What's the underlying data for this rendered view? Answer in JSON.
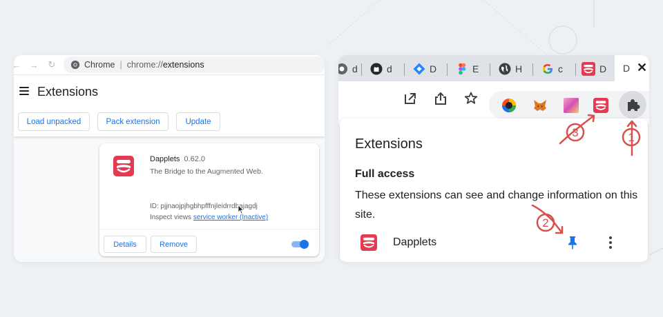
{
  "colors": {
    "background": "#eef1f4",
    "accent_blue": "#1a73e8",
    "annotation_red": "#d7504b",
    "dapplets_red": "#e23b52"
  },
  "left_window": {
    "omnibox": {
      "label": "Chrome",
      "separator": "|",
      "url_prefix": "chrome://",
      "url_path": "extensions"
    },
    "page_title": "Extensions",
    "buttons": {
      "load_unpacked": "Load unpacked",
      "pack_extension": "Pack extension",
      "update": "Update"
    },
    "extension_card": {
      "name": "Dapplets",
      "version": "0.62.0",
      "description": "The Bridge to the Augmented Web.",
      "id_line": "ID: pjjnaojpjhgbhpfffnjleidrrdbajagdj",
      "inspect_label": "Inspect views",
      "inspect_link": "service worker (Inactive)",
      "details_label": "Details",
      "remove_label": "Remove",
      "enabled": true
    }
  },
  "right_window": {
    "tabs": [
      {
        "icon": "chrome-icon",
        "letter": "d"
      },
      {
        "icon": "github-icon",
        "letter": "d"
      },
      {
        "icon": "jira-icon",
        "letter": "D"
      },
      {
        "icon": "figma-icon",
        "letter": "E"
      },
      {
        "icon": "globe-icon",
        "letter": "H"
      },
      {
        "icon": "google-icon",
        "letter": "c"
      },
      {
        "icon": "dapplets-icon",
        "letter": "D"
      }
    ],
    "active_tab_letter": "D",
    "close_glyph": "✕",
    "toolbar_icons": [
      "open-external-icon",
      "share-icon",
      "bookmark-star-icon"
    ],
    "pinned_extensions": [
      "color-wheel-icon",
      "metamask-icon",
      "gradient-extension-icon",
      "dapplets-icon"
    ],
    "popup": {
      "title": "Extensions",
      "section_title": "Full access",
      "section_desc": "These extensions can see and change information on this site.",
      "extension_name": "Dapplets"
    }
  },
  "annotations": [
    "1",
    "2",
    "3"
  ]
}
